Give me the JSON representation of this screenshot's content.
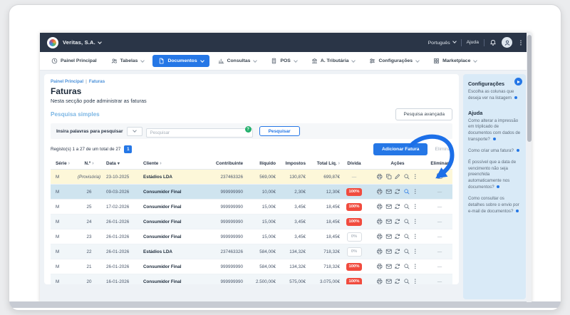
{
  "window": {
    "brand": "Veritas, S.A.",
    "language": "Português",
    "help": "Ajuda"
  },
  "nav": {
    "items": [
      {
        "label": "Painel Principal",
        "icon": "clock",
        "state": "normal",
        "chevron": false
      },
      {
        "label": "Tabelas",
        "icon": "users",
        "state": "normal",
        "chevron": true
      },
      {
        "label": "Documentos",
        "icon": "file",
        "state": "active",
        "chevron": true
      },
      {
        "label": "Consultas",
        "icon": "chart",
        "state": "normal",
        "chevron": true
      },
      {
        "label": "POS",
        "icon": "pos",
        "state": "normal",
        "chevron": true
      },
      {
        "label": "A. Tributária",
        "icon": "bank",
        "state": "normal",
        "chevron": true
      },
      {
        "label": "Configurações",
        "icon": "sliders",
        "state": "normal",
        "chevron": true
      },
      {
        "label": "Marketplace",
        "icon": "grid",
        "state": "normal",
        "chevron": true
      }
    ]
  },
  "page": {
    "breadcrumb_home": "Painel Principal",
    "breadcrumb_sep": "|",
    "breadcrumb_current": "Faturas",
    "title": "Faturas",
    "subtitle": "Nesta secção pode administrar as faturas"
  },
  "search": {
    "section_label": "Pesquisa simples",
    "advanced_button": "Pesquisa avançada",
    "field_label": "Insira palavras para pesquisar",
    "placeholder": "Pesquisar",
    "help_icon": "?",
    "submit_button": "Pesquisar"
  },
  "records": {
    "summary": "Registo(s) 1 a 27 de um total de 27",
    "page": "1",
    "add_button": "Adicionar Fatura",
    "delete_button": "Eliminar"
  },
  "table": {
    "columns": [
      {
        "label": "Série",
        "sort": "angle",
        "align": "left"
      },
      {
        "label": "N.º",
        "sort": "angle",
        "align": "center"
      },
      {
        "label": "Data",
        "sort": "down",
        "align": "left"
      },
      {
        "label": "Cliente",
        "sort": "angle",
        "align": "left"
      },
      {
        "label": "Contribuinte",
        "sort": "",
        "align": "right"
      },
      {
        "label": "Ilíquido",
        "sort": "",
        "align": "right"
      },
      {
        "label": "Impostos",
        "sort": "",
        "align": "right"
      },
      {
        "label": "Total Líq.",
        "sort": "angle",
        "align": "right"
      },
      {
        "label": "Dívida",
        "sort": "",
        "align": "center"
      },
      {
        "label": "Ações",
        "sort": "",
        "align": "center"
      },
      {
        "label": "Eliminar",
        "sort": "",
        "align": "center"
      }
    ],
    "rows": [
      {
        "serie": "M",
        "numero": "(Provisória)",
        "numero_style": "prov",
        "data": "23-10-2025",
        "cliente": "Estádios LDA",
        "contribuinte": "237463326",
        "iliquido": "569,00€",
        "impostos": "130,87€",
        "total": "699,87€",
        "divida": "—",
        "divida_type": "plain",
        "actions": [
          "print",
          "copy",
          "edit",
          "search",
          "more"
        ],
        "active_action": "",
        "eliminar": "checkbox",
        "highlight": "yellow"
      },
      {
        "serie": "M",
        "numero": "26",
        "numero_style": "",
        "data": "09-03-2026",
        "cliente": "Consumidor Final",
        "contribuinte": "999999990",
        "iliquido": "10,00€",
        "impostos": "2,30€",
        "total": "12,30€",
        "divida": "100%",
        "divida_type": "red",
        "actions": [
          "print",
          "mail",
          "refresh",
          "search",
          "more"
        ],
        "active_action": "search",
        "eliminar": "—",
        "highlight": "selected"
      },
      {
        "serie": "M",
        "numero": "25",
        "numero_style": "",
        "data": "17-02-2026",
        "cliente": "Consumidor Final",
        "contribuinte": "999999990",
        "iliquido": "15,00€",
        "impostos": "3,45€",
        "total": "18,45€",
        "divida": "100%",
        "divida_type": "red",
        "actions": [
          "print",
          "mail",
          "refresh",
          "search",
          "more"
        ],
        "active_action": "",
        "eliminar": "—",
        "highlight": "white"
      },
      {
        "serie": "M",
        "numero": "24",
        "numero_style": "",
        "data": "26-01-2026",
        "cliente": "Consumidor Final",
        "contribuinte": "999999990",
        "iliquido": "15,00€",
        "impostos": "3,45€",
        "total": "18,45€",
        "divida": "100%",
        "divida_type": "red",
        "actions": [
          "print",
          "mail",
          "refresh",
          "search",
          "more"
        ],
        "active_action": "",
        "eliminar": "—",
        "highlight": "stripe"
      },
      {
        "serie": "M",
        "numero": "23",
        "numero_style": "",
        "data": "26-01-2026",
        "cliente": "Consumidor Final",
        "contribuinte": "999999990",
        "iliquido": "15,00€",
        "impostos": "3,45€",
        "total": "18,45€",
        "divida": "0%",
        "divida_type": "outline",
        "actions": [
          "print",
          "mail",
          "refresh",
          "search",
          "more"
        ],
        "active_action": "",
        "eliminar": "—",
        "highlight": "white"
      },
      {
        "serie": "M",
        "numero": "22",
        "numero_style": "",
        "data": "26-01-2026",
        "cliente": "Estádios LDA",
        "contribuinte": "237463326",
        "iliquido": "584,00€",
        "impostos": "134,32€",
        "total": "718,32€",
        "divida": "0%",
        "divida_type": "outline",
        "actions": [
          "print",
          "mail",
          "refresh",
          "search",
          "more"
        ],
        "active_action": "",
        "eliminar": "—",
        "highlight": "stripe"
      },
      {
        "serie": "M",
        "numero": "21",
        "numero_style": "",
        "data": "26-01-2026",
        "cliente": "Consumidor Final",
        "contribuinte": "999999990",
        "iliquido": "584,00€",
        "impostos": "134,32€",
        "total": "718,32€",
        "divida": "100%",
        "divida_type": "red",
        "actions": [
          "print",
          "mail",
          "refresh",
          "search",
          "more"
        ],
        "active_action": "",
        "eliminar": "—",
        "highlight": "white"
      },
      {
        "serie": "M",
        "numero": "20",
        "numero_style": "",
        "data": "16-01-2026",
        "cliente": "Consumidor Final",
        "contribuinte": "999999990",
        "iliquido": "2.500,00€",
        "impostos": "575,00€",
        "total": "3.075,00€",
        "divida": "100%",
        "divida_type": "red",
        "actions": [
          "print",
          "mail",
          "refresh",
          "search",
          "more"
        ],
        "active_action": "",
        "eliminar": "—",
        "highlight": "stripe"
      }
    ]
  },
  "sidebar": {
    "config_title": "Configurações",
    "config_links": [
      {
        "text": "Escolha as colunas que deseja ver na listagem"
      }
    ],
    "help_title": "Ajuda",
    "links": [
      {
        "text": "Como alterar a impressão em triplicado de documentos com dados de transporte?"
      },
      {
        "text": "Como criar uma fatura?"
      },
      {
        "text": "É possível que a data de vencimento não seja preenchida automaticamente nos documentos?"
      },
      {
        "text": "Como consultar os detalhes sobre o envio por e-mail de documentos?"
      }
    ]
  },
  "colors": {
    "accent_blue": "#2577e6",
    "topbar_navy": "#2a3547",
    "badge_red": "#f14b3e",
    "sidebar_blue": "#d9eaf7",
    "row_selected": "#cfe4ef",
    "row_provisional": "#fdf7d9",
    "help_green": "#23b06c",
    "annotation_arrow": "#1c6fe8"
  }
}
